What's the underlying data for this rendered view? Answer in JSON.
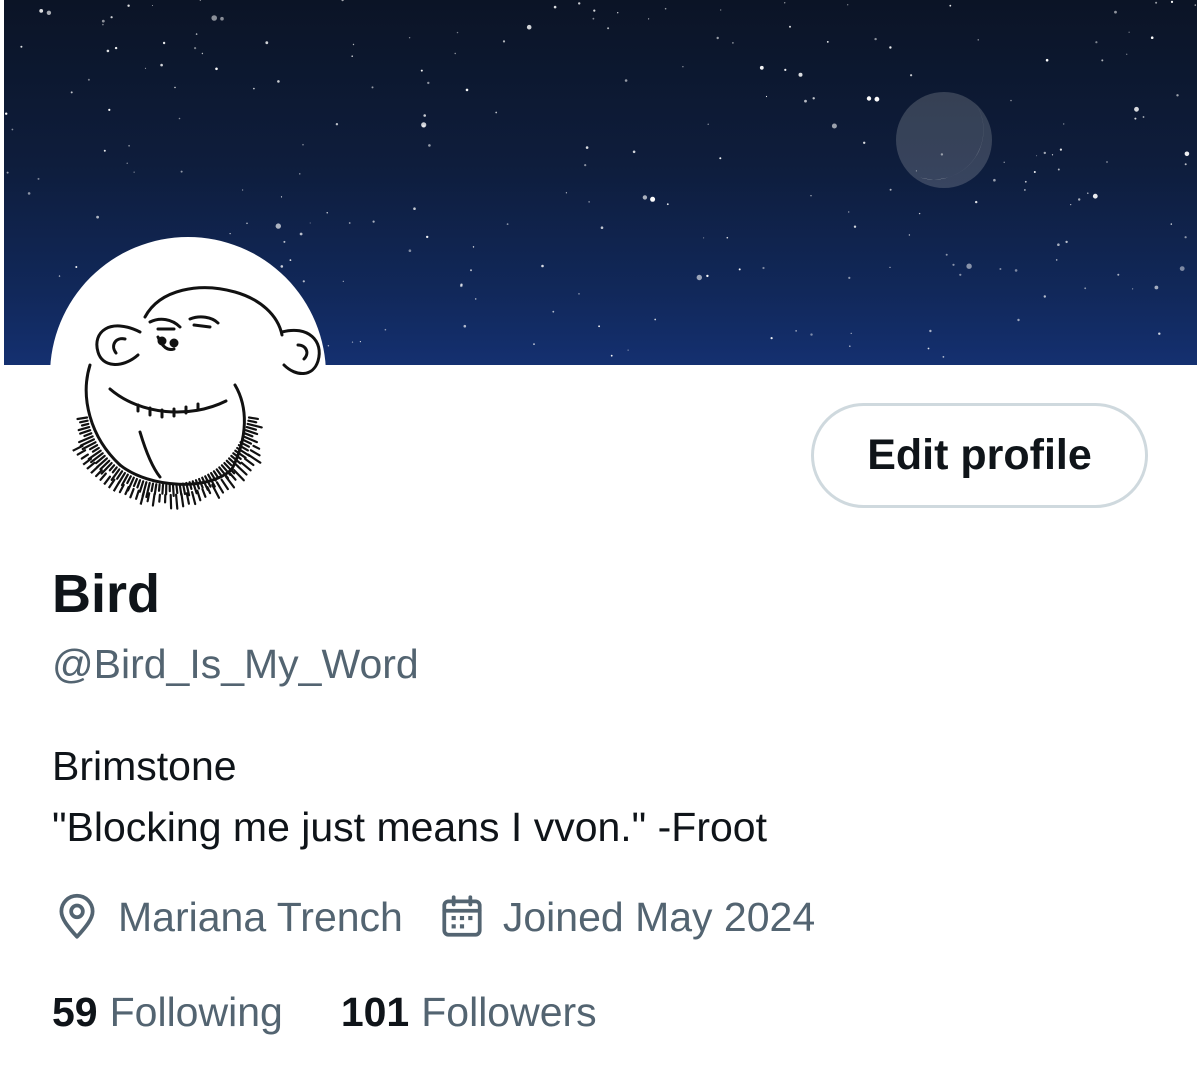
{
  "profile": {
    "display_name": "Bird",
    "handle": "@Bird_Is_My_Word",
    "bio_lines": [
      "Brimstone",
      "\"Blocking me just means I vvon.\" -Froot"
    ],
    "location": "Mariana Trench",
    "joined": "Joined May 2024",
    "edit_button_label": "Edit profile"
  },
  "stats": {
    "following_count": "59",
    "following_label": "Following",
    "followers_count": "101",
    "followers_label": "Followers"
  },
  "icons": {
    "location": "location-pin-icon",
    "joined": "calendar-icon"
  },
  "colors": {
    "text_primary": "#0f1419",
    "text_secondary": "#536471",
    "button_border": "#cfd9de",
    "banner_top": "#0b1426",
    "banner_bottom": "#143070"
  }
}
